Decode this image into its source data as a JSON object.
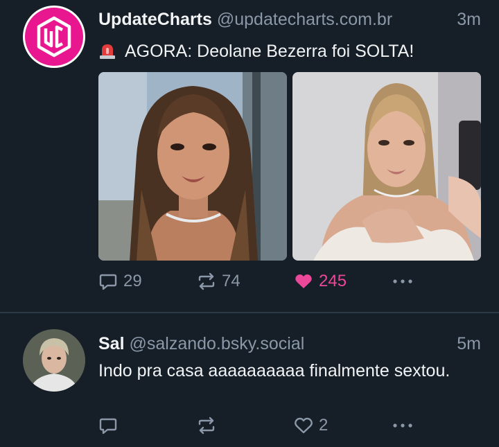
{
  "posts": [
    {
      "author_name": "UpdateCharts",
      "author_handle": "@updatecharts.com.br",
      "time": "3m",
      "text": "AGORA: Deolane Bezerra foi SOLTA!",
      "avatar_icon": "uc-logo-icon",
      "emoji_icon": "siren-icon",
      "replies": "29",
      "reposts": "74",
      "likes": "245",
      "liked": true,
      "accent_color": "#ec4899"
    },
    {
      "author_name": "Sal",
      "author_handle": "@salzando.bsky.social",
      "time": "5m",
      "text": "Indo pra casa aaaaaaaaaa finalmente sextou.",
      "replies": "",
      "reposts": "",
      "likes": "2",
      "liked": false
    }
  ]
}
